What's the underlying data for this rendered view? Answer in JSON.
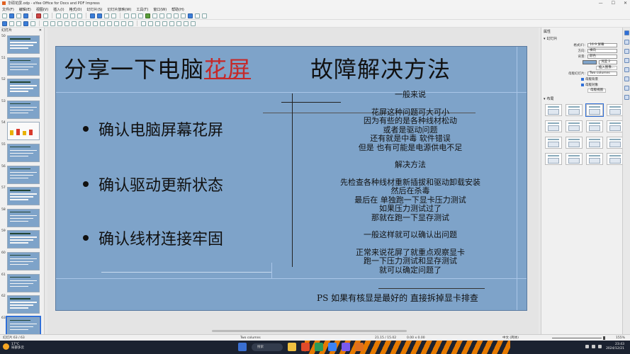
{
  "window": {
    "title": "华硕花屏.odp - eYee Office for Docs and PDF Impress",
    "controls": [
      "—",
      "☐",
      "✕"
    ]
  },
  "menu": [
    "文件(F)",
    "编辑(E)",
    "视图(V)",
    "插入(I)",
    "格式(O)",
    "幻灯片(S)",
    "幻灯片放映(W)",
    "工具(T)",
    "窗口(W)",
    "帮助(H)"
  ],
  "slide_panel": {
    "header": "幻灯片",
    "close": "✕",
    "thumbnails": [
      {
        "num": "50",
        "style": "text"
      },
      {
        "num": "51",
        "style": "text"
      },
      {
        "num": "52",
        "style": "text"
      },
      {
        "num": "53",
        "style": "text"
      },
      {
        "num": "54",
        "style": "chart"
      },
      {
        "num": "55",
        "style": "text"
      },
      {
        "num": "56",
        "style": "text"
      },
      {
        "num": "57",
        "style": "text"
      },
      {
        "num": "58",
        "style": "text"
      },
      {
        "num": "59",
        "style": "text"
      },
      {
        "num": "60",
        "style": "text"
      },
      {
        "num": "61",
        "style": "text"
      },
      {
        "num": "62",
        "style": "text"
      },
      {
        "num": "63",
        "style": "text"
      }
    ]
  },
  "slide": {
    "title_pre": "分享一下电脑",
    "title_red": "花屏",
    "title_post": "故障解决方法",
    "bullets": [
      "确认电脑屏幕花屏",
      "确认驱动更新状态",
      "确认线材连接牢固"
    ],
    "right_blocks": [
      {
        "lines": [
          "一般来说"
        ]
      },
      {
        "lines": [
          "花屏这种问题可大可小",
          "因为有些的是各种线材松动",
          "或者是驱动问题",
          "还有就是中毒  软件错误",
          "但是  也有可能是电源供电不足"
        ]
      },
      {
        "lines": [
          "解决方法"
        ]
      },
      {
        "lines": [
          "先检查各种线材重新插拔和驱动卸载安装",
          "然后在杀毒",
          "最后在  单独跑一下显卡压力测试",
          "如果压力测试过了",
          "那就在跑一下显存测试"
        ]
      },
      {
        "lines": [
          "一般这样就可以确认出问题"
        ]
      },
      {
        "lines": [
          "正常来说花屏了就重点观察显卡",
          "跑一下压力测试和显存测试",
          "就可以确定问题了"
        ]
      }
    ],
    "ps": "PS 如果有核显是最好的  直接拆掉显卡排查",
    "background": "#7ea3c9",
    "title_red_color": "#c62828"
  },
  "sidebar": {
    "header": "属性",
    "section_slide": "幻灯片",
    "format_label": "格式(F):",
    "format_value": "16:9 屏幕",
    "orientation_label": "方向:",
    "orientation_value": "横向",
    "background_label": "背景:",
    "background_value": "颜色",
    "color_value": "浅蓝 2",
    "insert_image": "插入图像...",
    "master_label": "母版幻灯片:",
    "master_value": "Two columns",
    "master_bg": "母版背景",
    "master_obj": "母版对象",
    "master_view": "母版视图",
    "section_layouts": "布局"
  },
  "status": {
    "slide_count": "幻灯片 63 / 63",
    "layout_name": "Two columns",
    "position": "21.15 / 15.02",
    "size": "0.00 x 0.00",
    "language": "中文 (简体)",
    "zoom": "155%"
  },
  "taskbar": {
    "temp": "17°C",
    "weather": "局部多云",
    "search": "搜索",
    "time": "23:43",
    "date": "2024/12/21"
  }
}
